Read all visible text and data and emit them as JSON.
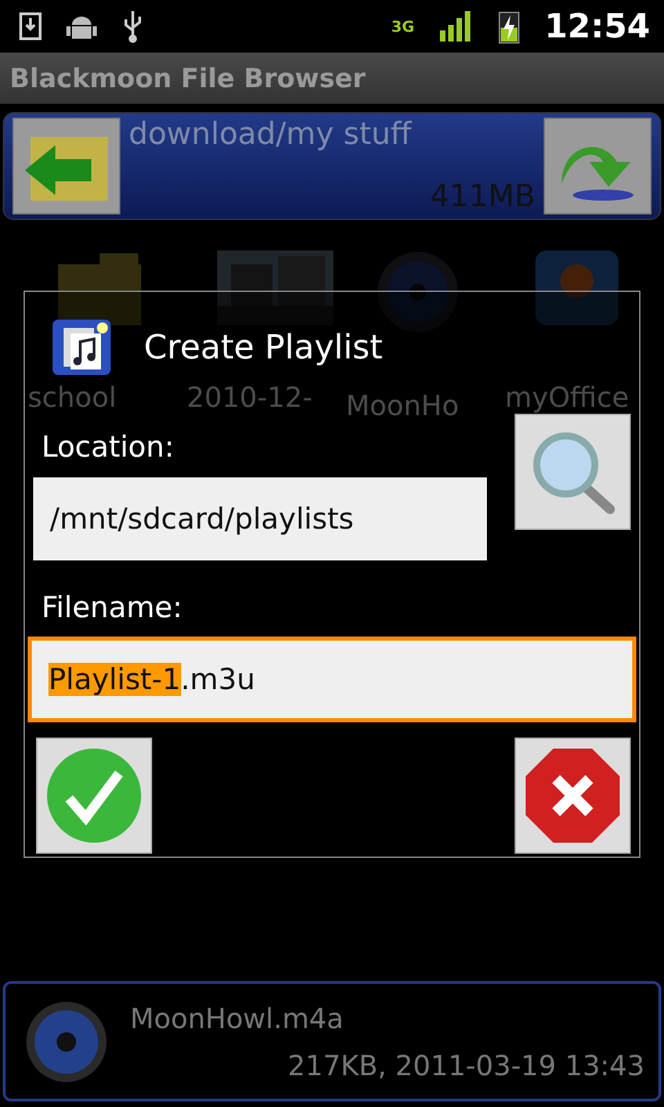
{
  "status_bar": {
    "network": "3G",
    "time": "12:54"
  },
  "window": {
    "title": "Blackmoon File Browser"
  },
  "path_bar": {
    "path": "download/my stuff",
    "free_space": "411MB"
  },
  "grid_items": [
    {
      "kind": "folder",
      "label": "school"
    },
    {
      "kind": "picture",
      "label": "2010-12-"
    },
    {
      "kind": "audio",
      "label": "MoonHo"
    },
    {
      "kind": "app",
      "label": "myOffice"
    }
  ],
  "dialog": {
    "title": "Create Playlist",
    "location_label": "Location:",
    "location_value": "/mnt/sdcard/playlists",
    "filename_label": "Filename:",
    "filename_selected": "Playlist-1",
    "filename_rest": ".m3u",
    "filename_focused": true
  },
  "selected_file": {
    "name": "MoonHowl.m4a",
    "details": "217KB, 2011-03-19 13:43"
  }
}
